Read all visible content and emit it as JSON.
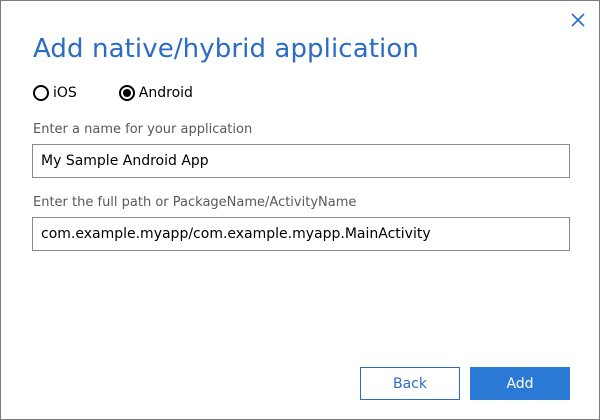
{
  "dialog": {
    "title": "Add native/hybrid application"
  },
  "platform": {
    "options": [
      {
        "label": "iOS",
        "selected": false
      },
      {
        "label": "Android",
        "selected": true
      }
    ]
  },
  "app_name": {
    "label": "Enter a name for your application",
    "value": "My Sample Android App"
  },
  "package_path": {
    "label": "Enter the full path or PackageName/ActivityName",
    "value": "com.example.myapp/com.example.myapp.MainActivity"
  },
  "buttons": {
    "back_label": "Back",
    "add_label": "Add"
  },
  "colors": {
    "accent": "#2b6cc4",
    "primary_button": "#2a7ad5",
    "label_text": "#595959",
    "field_border": "#8a8a8a"
  },
  "icons": {
    "close": "close-icon"
  }
}
